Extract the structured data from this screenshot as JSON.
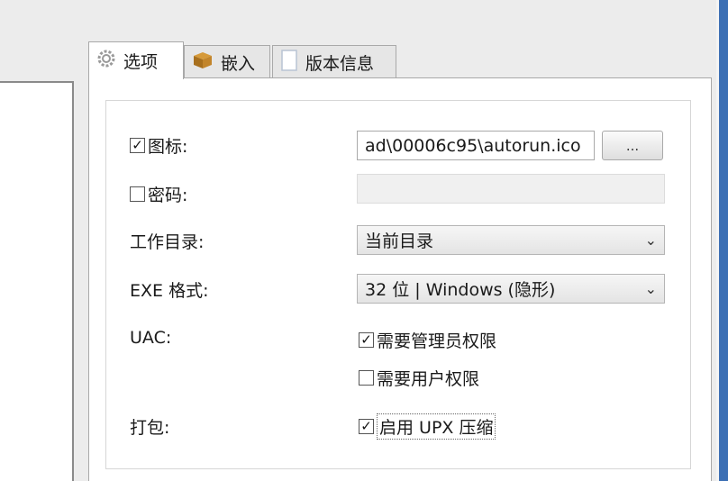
{
  "tabs": [
    {
      "label": "选项",
      "icon": "gear-icon"
    },
    {
      "label": "嵌入",
      "icon": "package-icon"
    },
    {
      "label": "版本信息",
      "icon": "document-icon"
    }
  ],
  "options": {
    "icon_label": "图标:",
    "icon_checked": "✓",
    "icon_path": "ad\\00006c95\\autorun.ico",
    "browse_label": "...",
    "password_label": "密码:",
    "password_value": "",
    "workdir_label": "工作目录:",
    "workdir_value": "当前目录",
    "exe_format_label": "EXE 格式:",
    "exe_format_value": "32 位 | Windows (隐形)",
    "uac_label": "UAC:",
    "uac_admin_label": "需要管理员权限",
    "uac_admin_checked": "✓",
    "uac_user_label": "需要用户权限",
    "pack_label": "打包:",
    "pack_upx_label": "启用 UPX 压缩",
    "pack_upx_checked": "✓",
    "dropdown_chevron": "⌄"
  },
  "colors": {
    "accent_edge": "#3c6fb4"
  }
}
